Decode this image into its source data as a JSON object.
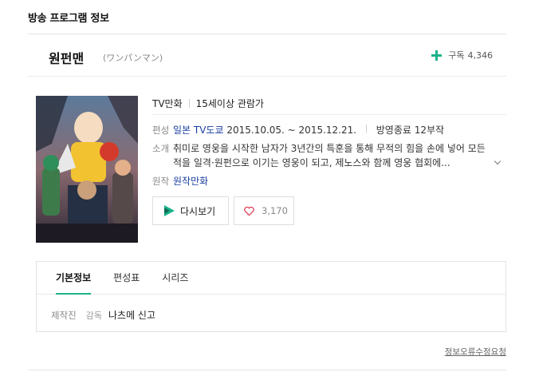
{
  "section": {
    "title": "방송 프로그램 정보"
  },
  "program": {
    "title": "원펀맨",
    "original_title": "(ワンパンマン)",
    "subscribe_label": "구독",
    "subscribe_count": "4,346"
  },
  "info": {
    "type": "TV만화",
    "rating": "15세이상 관람가",
    "schedule": {
      "label": "편성",
      "network": "일본 TV도쿄",
      "period": "2015.10.05. ~ 2015.12.21.",
      "status": "방영종료 12부작"
    },
    "synopsis": {
      "label": "소개",
      "text": "취미로 영웅을 시작한 남자가 3년간의 특훈을 통해 무적의 힘을 손에 넣어 모든 적을 일격·원펀으로 이기는 영웅이 되고, 제노스와 함께 영웅 협회에..."
    },
    "original": {
      "label": "원작",
      "value": "원작만화"
    }
  },
  "actions": {
    "replay_label": "다시보기",
    "like_count": "3,170"
  },
  "tabs": [
    {
      "label": "기본정보",
      "active": true
    },
    {
      "label": "편성표",
      "active": false
    },
    {
      "label": "시리즈",
      "active": false
    }
  ],
  "crew": {
    "label": "제작진",
    "role": "감독",
    "name": "나츠메 신고"
  },
  "footer": {
    "report_label": "정보오류수정요청"
  },
  "colors": {
    "accent": "#19b38b",
    "link": "#1a3fa0",
    "heart": "#e0435a"
  }
}
